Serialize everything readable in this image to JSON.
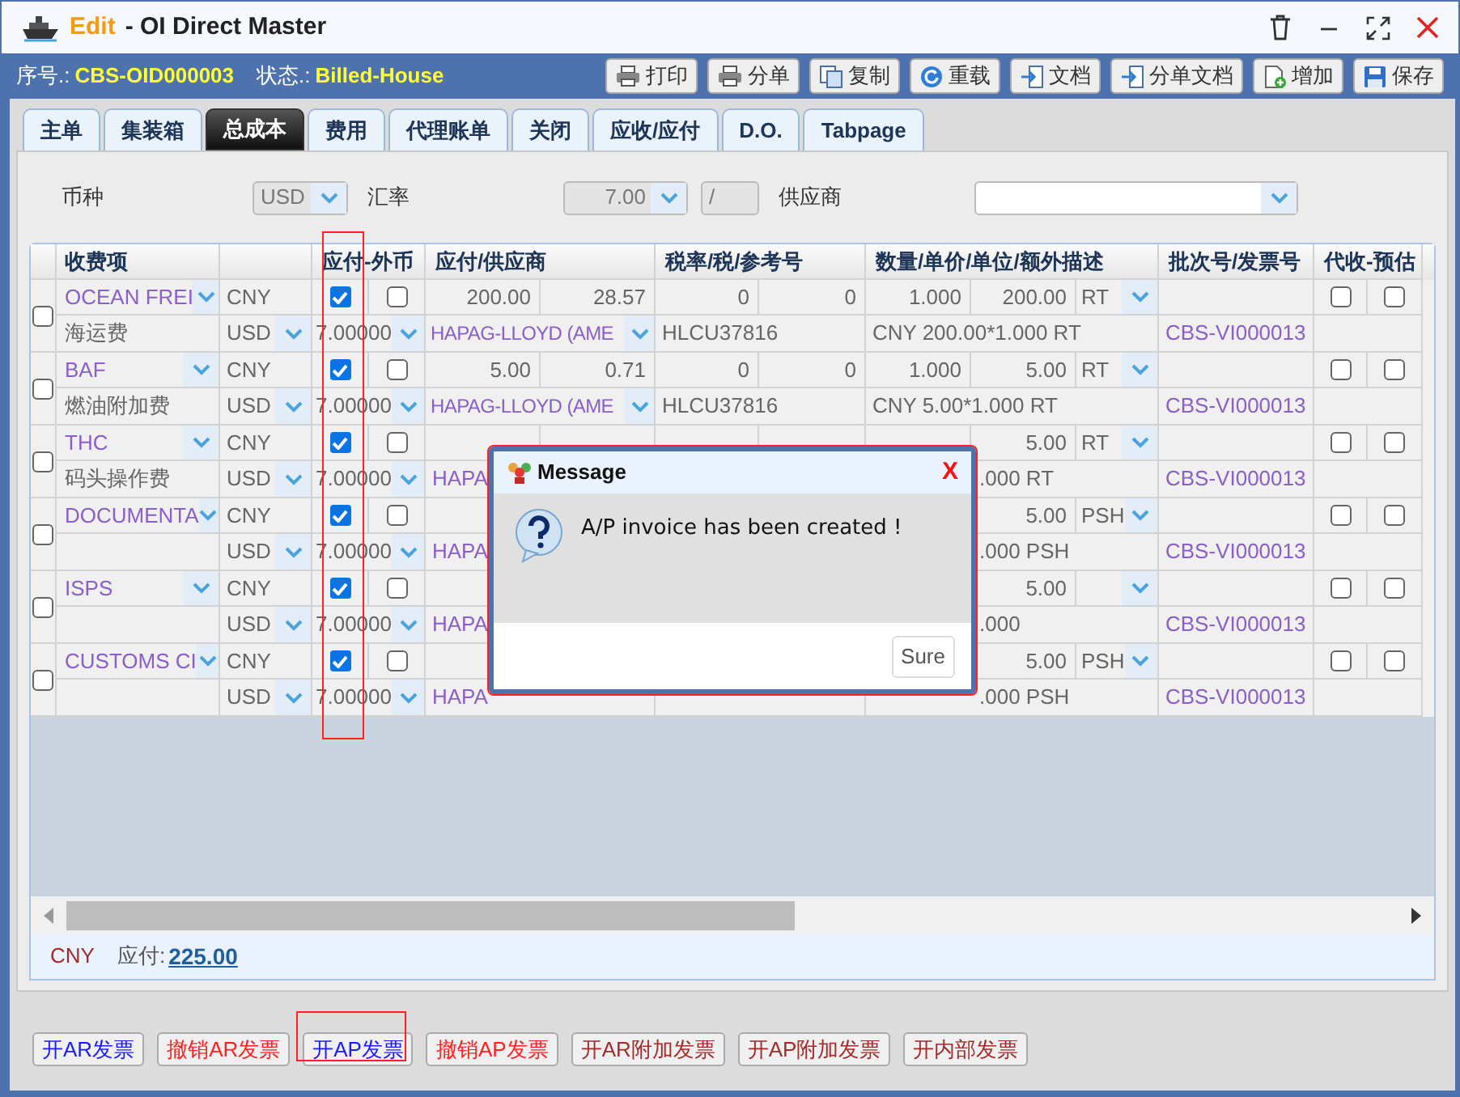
{
  "window": {
    "mode": "Edit",
    "title": "- OI Direct Master"
  },
  "header": {
    "fields": [
      {
        "label": "序号.:",
        "value": "CBS-OID000003"
      },
      {
        "label": "状态.:",
        "value": "Billed-House"
      }
    ],
    "buttons": [
      {
        "label": "打印",
        "kind": "print"
      },
      {
        "label": "分单",
        "kind": "print"
      },
      {
        "label": "复制",
        "kind": "copy"
      },
      {
        "label": "重载",
        "kind": "reload"
      },
      {
        "label": "文档",
        "kind": "import"
      },
      {
        "label": "分单文档",
        "kind": "import"
      },
      {
        "label": "增加",
        "kind": "add"
      },
      {
        "label": "保存",
        "kind": "save"
      }
    ]
  },
  "tabs": [
    {
      "label": "主单",
      "selected": false
    },
    {
      "label": "集装箱",
      "selected": false
    },
    {
      "label": "总成本",
      "selected": true
    },
    {
      "label": "费用",
      "selected": false
    },
    {
      "label": "代理账单",
      "selected": false
    },
    {
      "label": "关闭",
      "selected": false
    },
    {
      "label": "应收/应付",
      "selected": false
    },
    {
      "label": "D.O.",
      "selected": false
    },
    {
      "label": "Tabpage",
      "selected": false
    }
  ],
  "filter": {
    "currency_label": "币种",
    "currency": "USD",
    "rate_label": "汇率",
    "rate": "7.00",
    "rate_divider": "/",
    "supplier_label": "供应商"
  },
  "table": {
    "columns": [
      "收费项",
      "应付-外币",
      "应付/供应商",
      "税率/税/参考号",
      "数量/单价/单位/额外描述",
      "批次号/发票号",
      "代收-预估"
    ],
    "rows": [
      {
        "selected": false,
        "charge": "OCEAN FREI",
        "currency": "CNY",
        "payable": true,
        "foreign": false,
        "amount": "200.00",
        "amount_2": "28.57",
        "tax_rate": "0",
        "tax": "0",
        "qty": "1.000",
        "price": "200.00",
        "unit": "RT",
        "collect": false,
        "estimate": false,
        "name": "海运费",
        "pay_currency": "USD",
        "rate": "7.00000",
        "supplier": "HAPAG-LLOYD (AME",
        "ref": "HLCU37816",
        "description": "CNY 200.00*1.000 RT",
        "invoice": "CBS-VI000013"
      },
      {
        "selected": false,
        "charge": "BAF",
        "currency": "CNY",
        "payable": true,
        "foreign": false,
        "amount": "5.00",
        "amount_2": "0.71",
        "tax_rate": "0",
        "tax": "0",
        "qty": "1.000",
        "price": "5.00",
        "unit": "RT",
        "collect": false,
        "estimate": false,
        "name": "燃油附加费",
        "pay_currency": "USD",
        "rate": "7.00000",
        "supplier": "HAPAG-LLOYD (AME",
        "ref": "HLCU37816",
        "description": "CNY 5.00*1.000 RT",
        "invoice": "CBS-VI000013"
      },
      {
        "selected": false,
        "charge": "THC",
        "currency": "CNY",
        "payable": true,
        "foreign": false,
        "price": "5.00",
        "unit": "RT",
        "collect": false,
        "estimate": false,
        "name": "码头操作费",
        "pay_currency": "USD",
        "rate": "7.00000",
        "supplier_part": "HAPA",
        "description_part": ".000 RT",
        "invoice": "CBS-VI000013"
      },
      {
        "selected": false,
        "charge": "DOCUMENTA",
        "currency": "CNY",
        "payable": true,
        "foreign": false,
        "price": "5.00",
        "unit": "PSH",
        "collect": false,
        "estimate": false,
        "pay_currency": "USD",
        "rate": "7.00000",
        "supplier_part": "HAPA",
        "description_part": ".000 PSH",
        "invoice": "CBS-VI000013"
      },
      {
        "selected": false,
        "charge": "ISPS",
        "currency": "CNY",
        "payable": true,
        "foreign": false,
        "price": "5.00",
        "collect": false,
        "estimate": false,
        "pay_currency": "USD",
        "rate": "7.00000",
        "supplier_part": "HAPA",
        "description_part": ".000",
        "invoice": "CBS-VI000013"
      },
      {
        "selected": false,
        "charge": "CUSTOMS CI",
        "currency": "CNY",
        "payable": true,
        "foreign": false,
        "price": "5.00",
        "unit": "PSH",
        "collect": false,
        "estimate": false,
        "pay_currency": "USD",
        "rate": "7.00000",
        "supplier_part": "HAPA",
        "description_part": ".000 PSH",
        "invoice": "CBS-VI000013"
      }
    ]
  },
  "summary": {
    "currency": "CNY",
    "label": "应付:",
    "amount": "225.00"
  },
  "actions": [
    {
      "label": "开AR发票",
      "color": "#1a1aff"
    },
    {
      "label": "撤销AR发票",
      "color": "#ff2020"
    },
    {
      "label": "开AP发票",
      "color": "#1a1aff"
    },
    {
      "label": "撤销AP发票",
      "color": "#ff2020"
    },
    {
      "label": "开AR附加发票",
      "color": "#a52a2a"
    },
    {
      "label": "开AP附加发票",
      "color": "#a52a2a"
    },
    {
      "label": "开内部发票",
      "color": "#a52a2a"
    }
  ],
  "dialog": {
    "title": "Message",
    "close": "X",
    "message": "A/P invoice has been created !",
    "button": "Sure"
  }
}
